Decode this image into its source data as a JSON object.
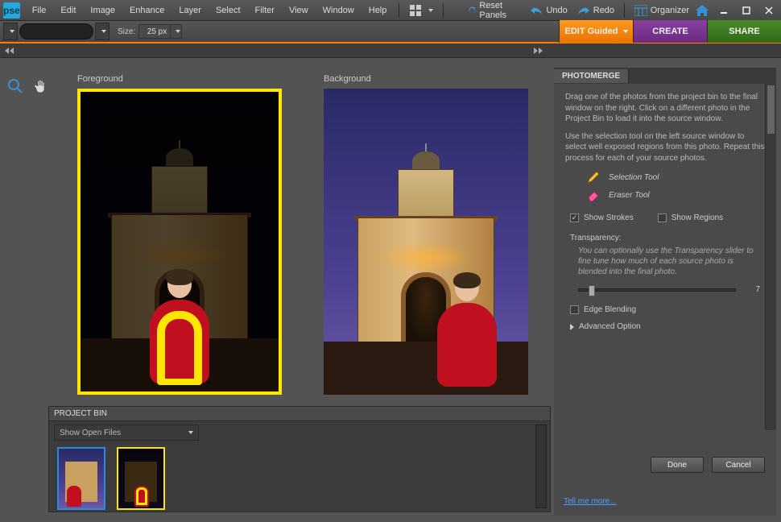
{
  "app": {
    "logo_text": "pse"
  },
  "menu": [
    "File",
    "Edit",
    "Image",
    "Enhance",
    "Layer",
    "Select",
    "Filter",
    "View",
    "Window",
    "Help"
  ],
  "topbar": {
    "reset": "Reset Panels",
    "undo": "Undo",
    "redo": "Redo",
    "organizer": "Organizer"
  },
  "options": {
    "size_label": "Size:",
    "size_value": "25 px"
  },
  "modes": {
    "edit": "EDIT Guided",
    "create": "CREATE",
    "share": "SHARE"
  },
  "canvas": {
    "foreground_label": "Foreground",
    "background_label": "Background"
  },
  "bin": {
    "title": "PROJECT BIN",
    "dropdown": "Show Open Files"
  },
  "panel": {
    "tab": "PHOTOMERGE",
    "para1": "Drag one of the photos from the project bin to the final window on the right. Click on a different photo in the Project Bin to load it into the source window.",
    "para2": "Use the selection tool on the left source window to select well exposed regions from this photo. Repeat this process for each of your source photos.",
    "tool_selection": "Selection Tool",
    "tool_eraser": "Eraser Tool",
    "show_strokes": "Show Strokes",
    "show_regions": "Show Regions",
    "transparency_label": "Transparency:",
    "transparency_hint": "You can optionally use the Transparency slider to fine tune how much of each source photo is blended into the final photo.",
    "transparency_value": "7",
    "edge_blending": "Edge Blending",
    "advanced": "Advanced Option",
    "done": "Done",
    "cancel": "Cancel",
    "tell_more": "Tell me more..."
  }
}
